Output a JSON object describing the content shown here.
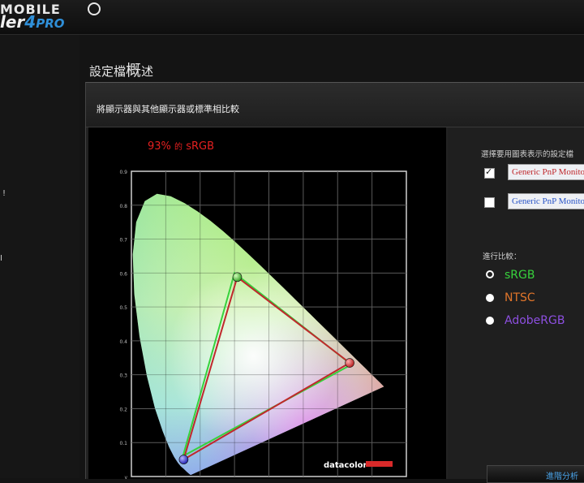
{
  "brand": {
    "line1": "MOBILE",
    "line2_prefix": "ler",
    "line2_num": "4",
    "line2_suffix": "PRO"
  },
  "sidebar": {
    "mark1": "!",
    "mark2": "I"
  },
  "page_title_prefix": "設定檔",
  "page_title_big": "概",
  "page_title_suffix": "述",
  "panel": {
    "header": "將顯示器與其他顯示器或標準相比較",
    "coverage_pct": "93%",
    "coverage_of": "的",
    "coverage_std": "sRGB"
  },
  "right": {
    "select_label": "選擇要用圖表表示的設定檔",
    "profiles": [
      {
        "label": "Generic PnP Monitor",
        "checked": true,
        "color": "#c0282c"
      },
      {
        "label": "Generic PnP Monitor",
        "checked": false,
        "color": "#2a55c8"
      }
    ],
    "compare_label": "進行比較：",
    "options": [
      {
        "label": "sRGB",
        "color": "#37d23c",
        "selected": true
      },
      {
        "label": "NTSC",
        "color": "#e0752a",
        "selected": false
      },
      {
        "label": "AdobeRGB",
        "color": "#8d4fe0",
        "selected": false
      }
    ],
    "advanced_button": "進階分析"
  },
  "chart": {
    "y_ticks": [
      "0.9",
      "0.8",
      "0.7",
      "0.6",
      "0.5",
      "0.4",
      "0.3",
      "0.2",
      "0.1",
      "y"
    ],
    "watermark": "datacolor"
  },
  "chart_data": {
    "type": "scatter",
    "title": "",
    "xlabel": "",
    "ylabel": "y",
    "xlim": [
      0,
      0.8
    ],
    "ylim": [
      0,
      0.9
    ],
    "series": [
      {
        "name": "sRGB",
        "color": "#37d23c",
        "values": [
          [
            0.64,
            0.33
          ],
          [
            0.3,
            0.6
          ],
          [
            0.15,
            0.06
          ]
        ]
      },
      {
        "name": "Generic PnP Monitor",
        "color": "#c0282c",
        "values": [
          [
            0.635,
            0.335
          ],
          [
            0.308,
            0.588
          ],
          [
            0.152,
            0.05
          ]
        ]
      }
    ]
  }
}
